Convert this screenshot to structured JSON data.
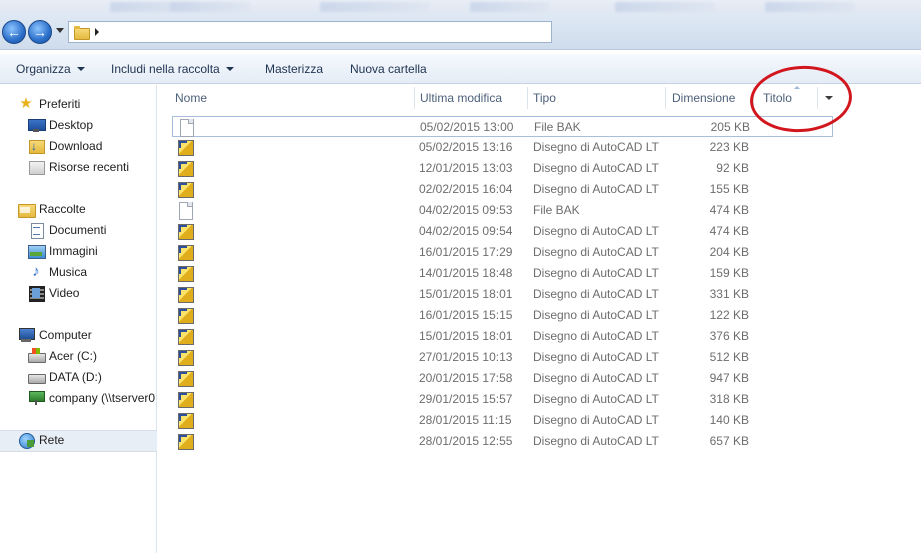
{
  "toolbar": {
    "organize": "Organizza",
    "include": "Includi nella raccolta",
    "burn": "Masterizza",
    "new_folder": "Nuova cartella"
  },
  "sidebar": {
    "favorites": "Preferiti",
    "desktop": "Desktop",
    "download": "Download",
    "recent": "Risorse recenti",
    "libraries": "Raccolte",
    "documents": "Documenti",
    "pictures": "Immagini",
    "music": "Musica",
    "video": "Video",
    "computer": "Computer",
    "drive_c": "Acer (C:)",
    "drive_d": "DATA (D:)",
    "network_drive": "company (\\\\tserver0",
    "network": "Rete"
  },
  "columns": {
    "name": "Nome",
    "modified": "Ultima modifica",
    "type": "Tipo",
    "size": "Dimensione",
    "title": "Titolo"
  },
  "files": [
    {
      "icon": "bak-file-icon",
      "date": "05/02/2015 13:00",
      "type": "File BAK",
      "size": "205 KB"
    },
    {
      "icon": "autocad-file-icon",
      "date": "05/02/2015 13:16",
      "type": "Disegno di AutoCAD LT",
      "size": "223 KB"
    },
    {
      "icon": "autocad-file-icon",
      "date": "12/01/2015 13:03",
      "type": "Disegno di AutoCAD LT",
      "size": "92 KB"
    },
    {
      "icon": "autocad-file-icon",
      "date": "02/02/2015 16:04",
      "type": "Disegno di AutoCAD LT",
      "size": "155 KB"
    },
    {
      "icon": "bak-file-icon",
      "date": "04/02/2015 09:53",
      "type": "File BAK",
      "size": "474 KB"
    },
    {
      "icon": "autocad-file-icon",
      "date": "04/02/2015 09:54",
      "type": "Disegno di AutoCAD LT",
      "size": "474 KB"
    },
    {
      "icon": "autocad-file-icon",
      "date": "16/01/2015 17:29",
      "type": "Disegno di AutoCAD LT",
      "size": "204 KB"
    },
    {
      "icon": "autocad-file-icon",
      "date": "14/01/2015 18:48",
      "type": "Disegno di AutoCAD LT",
      "size": "159 KB"
    },
    {
      "icon": "autocad-file-icon",
      "date": "15/01/2015 18:01",
      "type": "Disegno di AutoCAD LT",
      "size": "331 KB"
    },
    {
      "icon": "autocad-file-icon",
      "date": "16/01/2015 15:15",
      "type": "Disegno di AutoCAD LT",
      "size": "122 KB"
    },
    {
      "icon": "autocad-file-icon",
      "date": "15/01/2015 18:01",
      "type": "Disegno di AutoCAD LT",
      "size": "376 KB"
    },
    {
      "icon": "autocad-file-icon",
      "date": "27/01/2015 10:13",
      "type": "Disegno di AutoCAD LT",
      "size": "512 KB"
    },
    {
      "icon": "autocad-file-icon",
      "date": "20/01/2015 17:58",
      "type": "Disegno di AutoCAD LT",
      "size": "947 KB"
    },
    {
      "icon": "autocad-file-icon",
      "date": "29/01/2015 15:57",
      "type": "Disegno di AutoCAD LT",
      "size": "318 KB"
    },
    {
      "icon": "autocad-file-icon",
      "date": "28/01/2015 11:15",
      "type": "Disegno di AutoCAD LT",
      "size": "140 KB"
    },
    {
      "icon": "autocad-file-icon",
      "date": "28/01/2015 12:55",
      "type": "Disegno di AutoCAD LT",
      "size": "657 KB"
    }
  ],
  "colors": {
    "annotation": "#d2161d",
    "header_text": "#4c607a",
    "row_text": "#6d6d6d"
  }
}
